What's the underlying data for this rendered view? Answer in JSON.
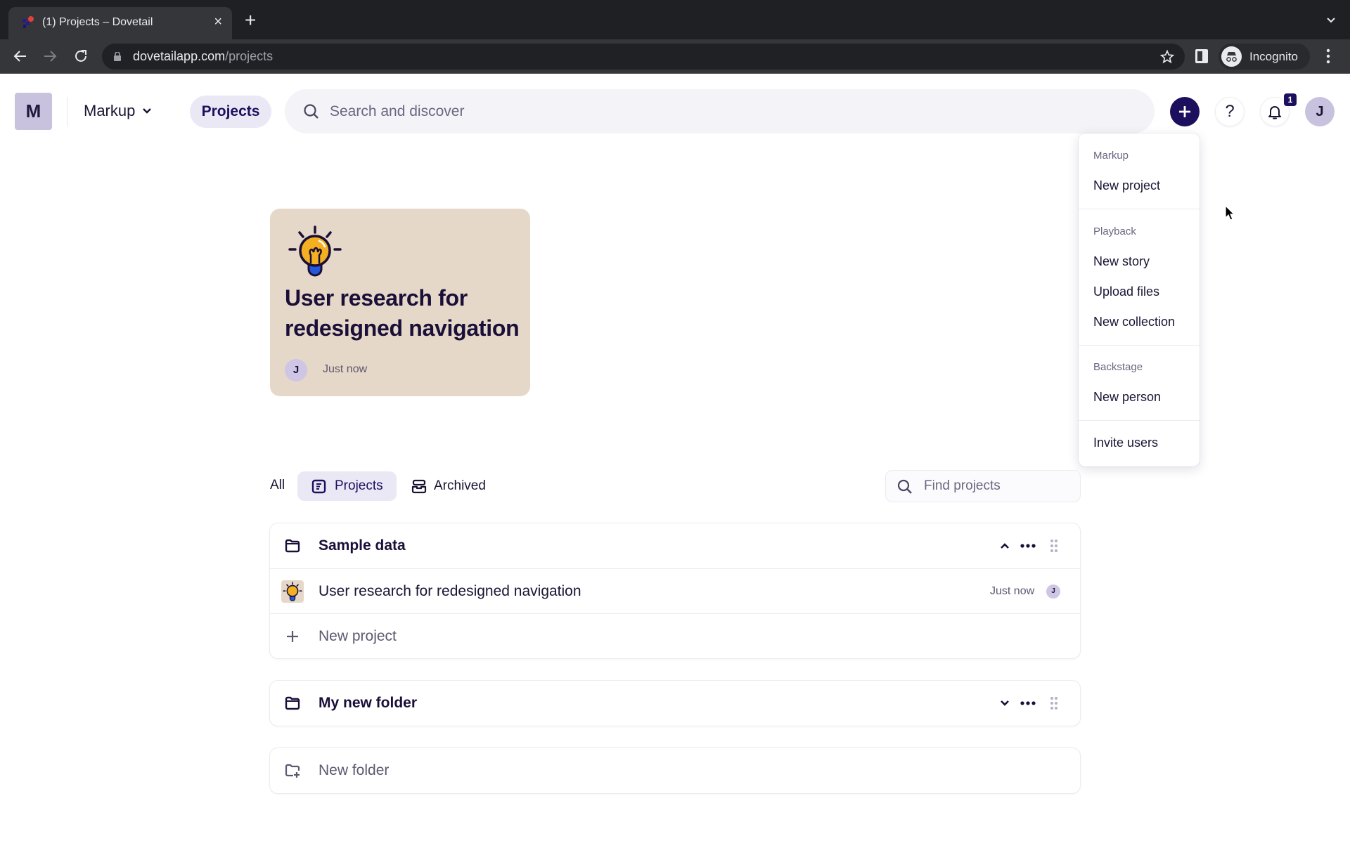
{
  "browser": {
    "tab_title": "(1) Projects – Dovetail",
    "url_domain": "dovetailapp.com",
    "url_path": "/projects",
    "profile_label": "Incognito"
  },
  "header": {
    "workspace_initial": "M",
    "workspace_name": "Markup",
    "nav_projects": "Projects",
    "search_placeholder": "Search and discover",
    "help_label": "?",
    "notification_count": "1",
    "user_initial": "J",
    "accent_color": "#1c0f5e"
  },
  "create_menu": {
    "sections": [
      {
        "label": "Markup",
        "items": [
          "New project"
        ]
      },
      {
        "label": "Playback",
        "items": [
          "New story",
          "Upload files",
          "New collection"
        ]
      },
      {
        "label": "Backstage",
        "items": [
          "New person"
        ]
      },
      {
        "label": "",
        "items": [
          "Invite users"
        ]
      }
    ]
  },
  "featured_project": {
    "icon": "lightbulb-icon",
    "title": "User research for redesigned navigation",
    "owner_initial": "J",
    "updated": "Just now"
  },
  "filters": {
    "all": "All",
    "projects": "Projects",
    "archived": "Archived",
    "active": "Projects",
    "find_placeholder": "Find projects"
  },
  "folders": [
    {
      "name": "Sample data",
      "expanded": true,
      "projects": [
        {
          "title": "User research for redesigned navigation",
          "updated": "Just now",
          "owner_initial": "J"
        }
      ],
      "new_project_label": "New project"
    },
    {
      "name": "My new folder",
      "expanded": false,
      "projects": []
    }
  ],
  "new_folder_label": "New folder"
}
